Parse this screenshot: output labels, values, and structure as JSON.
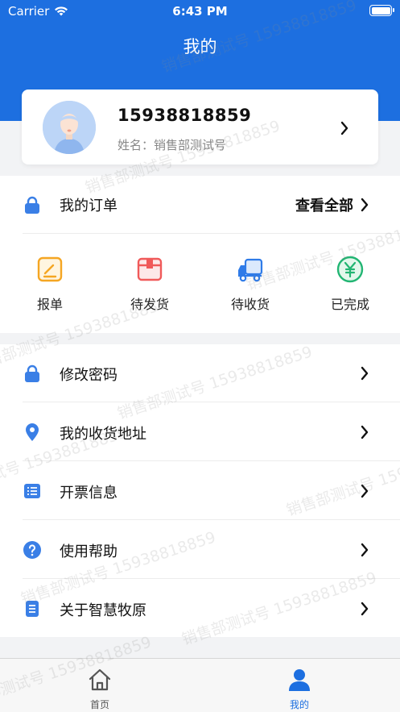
{
  "status_bar": {
    "carrier": "Carrier",
    "time": "6:43 PM"
  },
  "header": {
    "title": "我的"
  },
  "profile": {
    "phone": "15938818859",
    "name_line": "姓名：销售部测试号"
  },
  "orders": {
    "title": "我的订单",
    "view_all": "查看全部",
    "statuses": [
      {
        "label": "报单",
        "icon": "form-edit-icon",
        "color": "#f5a623"
      },
      {
        "label": "待发货",
        "icon": "package-icon",
        "color": "#f05a5a"
      },
      {
        "label": "待收货",
        "icon": "truck-icon",
        "color": "#2f7be8"
      },
      {
        "label": "已完成",
        "icon": "yuan-coin-icon",
        "color": "#22b573"
      }
    ]
  },
  "menu": [
    {
      "label": "修改密码",
      "icon": "lock-icon"
    },
    {
      "label": "我的收货地址",
      "icon": "location-pin-icon"
    },
    {
      "label": "开票信息",
      "icon": "invoice-list-icon"
    },
    {
      "label": "使用帮助",
      "icon": "help-circle-icon"
    },
    {
      "label": "关于智慧牧原",
      "icon": "info-doc-icon"
    }
  ],
  "tabs": [
    {
      "label": "首页",
      "icon": "home-icon",
      "active": false
    },
    {
      "label": "我的",
      "icon": "user-icon",
      "active": true
    }
  ],
  "watermark": "销售部测试号 15938818859",
  "colors": {
    "primary": "#1d6fe0",
    "active_tab": "#1d6fe0",
    "inactive_tab": "#555555"
  }
}
